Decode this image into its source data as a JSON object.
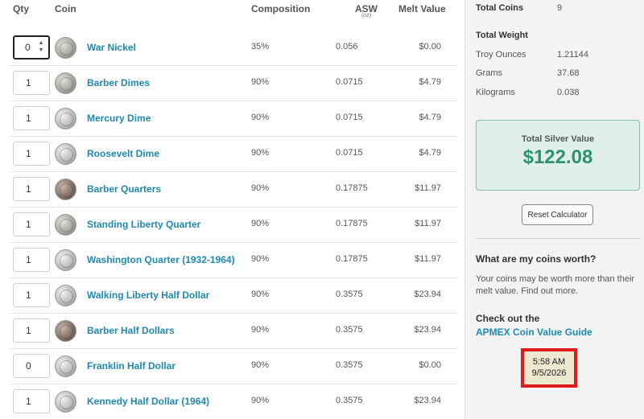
{
  "table": {
    "headers": {
      "qty": "Qty",
      "coin": "Coin",
      "composition": "Composition",
      "asw": "ASW",
      "asw_unit": "(oz)",
      "melt": "Melt Value"
    },
    "rows": [
      {
        "qty": "0",
        "name": "War Nickel",
        "composition": "35%",
        "asw": "0.056",
        "melt": "$0.00",
        "coin": "mid"
      },
      {
        "qty": "1",
        "name": "Barber Dimes",
        "composition": "90%",
        "asw": "0.0715",
        "melt": "$4.79",
        "coin": "mid"
      },
      {
        "qty": "1",
        "name": "Mercury Dime",
        "composition": "90%",
        "asw": "0.0715",
        "melt": "$4.79",
        "coin": "silver"
      },
      {
        "qty": "1",
        "name": "Roosevelt Dime",
        "composition": "90%",
        "asw": "0.0715",
        "melt": "$4.79",
        "coin": "silver"
      },
      {
        "qty": "1",
        "name": "Barber Quarters",
        "composition": "90%",
        "asw": "0.17875",
        "melt": "$11.97",
        "coin": "dark"
      },
      {
        "qty": "1",
        "name": "Standing Liberty Quarter",
        "composition": "90%",
        "asw": "0.17875",
        "melt": "$11.97",
        "coin": "mid"
      },
      {
        "qty": "1",
        "name": "Washington Quarter (1932-1964)",
        "composition": "90%",
        "asw": "0.17875",
        "melt": "$11.97",
        "coin": "silver"
      },
      {
        "qty": "1",
        "name": "Walking Liberty Half Dollar",
        "composition": "90%",
        "asw": "0.3575",
        "melt": "$23.94",
        "coin": "silver"
      },
      {
        "qty": "1",
        "name": "Barber Half Dollars",
        "composition": "90%",
        "asw": "0.3575",
        "melt": "$23.94",
        "coin": "dark"
      },
      {
        "qty": "0",
        "name": "Franklin Half Dollar",
        "composition": "90%",
        "asw": "0.3575",
        "melt": "$0.00",
        "coin": "silver"
      },
      {
        "qty": "1",
        "name": "Kennedy Half Dollar (1964)",
        "composition": "90%",
        "asw": "0.3575",
        "melt": "$23.94",
        "coin": "silver"
      }
    ]
  },
  "summary": {
    "total_coins_label": "Total Coins",
    "total_coins_value": "9",
    "total_weight_label": "Total Weight",
    "troy_label": "Troy Ounces",
    "troy_value": "1.21144",
    "grams_label": "Grams",
    "grams_value": "37.68",
    "kg_label": "Kilograms",
    "kg_value": "0.038",
    "silver_value_label": "Total Silver Value",
    "silver_value": "$122.08",
    "reset_label": "Reset Calculator",
    "question": "What are my coins worth?",
    "paragraph": "Your coins may be worth more than their melt value. Find out more.",
    "checkout": "Check out the",
    "guide_link": "APMEX Coin Value Guide"
  },
  "clock": {
    "time": "5:58 AM",
    "date": "9/5/2026"
  },
  "colors": {
    "link": "#1f8ab0",
    "accent_green": "#2e9172",
    "panel": "#f3f3f3",
    "clock_border": "#e01b1b"
  }
}
